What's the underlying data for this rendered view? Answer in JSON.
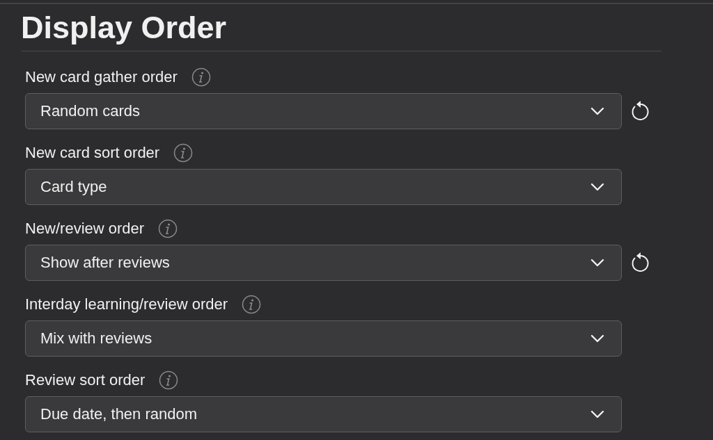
{
  "section": {
    "title": "Display Order"
  },
  "settings": [
    {
      "label": "New card gather order",
      "value": "Random cards",
      "modified": true
    },
    {
      "label": "New card sort order",
      "value": "Card type",
      "modified": false
    },
    {
      "label": "New/review order",
      "value": "Show after reviews",
      "modified": true
    },
    {
      "label": "Interday learning/review order",
      "value": "Mix with reviews",
      "modified": false
    },
    {
      "label": "Review sort order",
      "value": "Due date, then random",
      "modified": false
    }
  ]
}
